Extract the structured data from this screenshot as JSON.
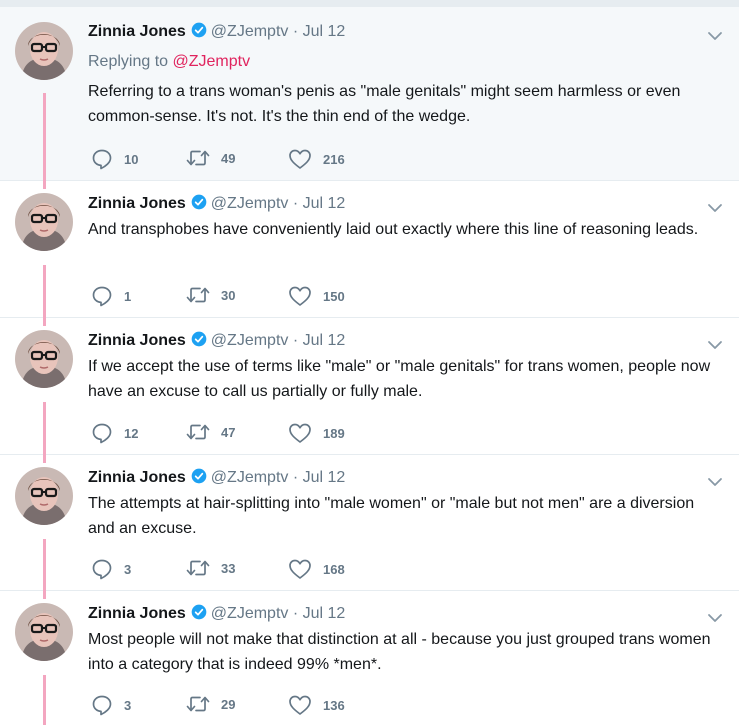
{
  "author": {
    "name": "Zinnia Jones",
    "handle": "@ZJemptv"
  },
  "colors": {
    "accent_pink": "#e0245e",
    "thread_line": "#f3a6c0",
    "muted": "#657786",
    "verified": "#1da1f2"
  },
  "icons": {
    "reply": "reply-icon",
    "retweet": "retweet-icon",
    "like": "heart-icon",
    "verified": "verified-badge-icon",
    "menu": "chevron-down-icon"
  },
  "tweets": [
    {
      "time": "Jul 12",
      "replying_prefix": "Replying to",
      "replying_handle": "@ZJemptv",
      "text": "Referring to a trans woman's penis as \"male genitals\" might seem harmless or even common-sense. It's not. It's the thin end of the wedge.",
      "replies": "10",
      "retweets": "49",
      "likes": "216"
    },
    {
      "time": "Jul 12",
      "text": "And transphobes have conveniently laid out exactly where this line of reasoning leads.",
      "replies": "1",
      "retweets": "30",
      "likes": "150"
    },
    {
      "time": "Jul 12",
      "text": "If we accept the use of terms like \"male\" or \"male genitals\" for trans women, people now have an excuse to call us partially or fully male.",
      "replies": "12",
      "retweets": "47",
      "likes": "189"
    },
    {
      "time": "Jul 12",
      "text": "The attempts at hair-splitting into \"male women\" or \"male but not men\" are a diversion and an excuse.",
      "replies": "3",
      "retweets": "33",
      "likes": "168"
    },
    {
      "time": "Jul 12",
      "text": "Most people will not make that distinction at all - because you just grouped trans women into a category that is indeed 99% *men*.",
      "replies": "3",
      "retweets": "29",
      "likes": "136"
    }
  ]
}
